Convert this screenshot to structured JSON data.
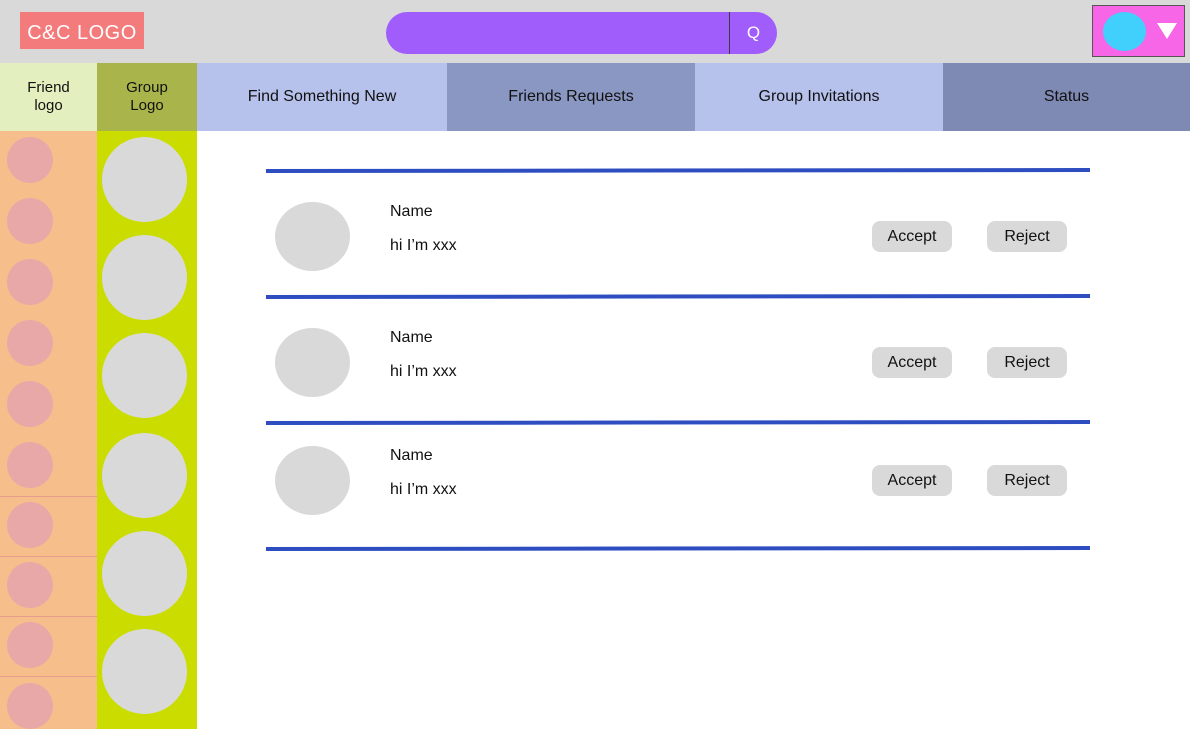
{
  "header": {
    "logo_text": "C&C LOGO",
    "search": {
      "placeholder": "",
      "button_label": "Q"
    },
    "profile": {
      "avatar_icon": "user-avatar",
      "menu_icon": "caret-down-icon"
    }
  },
  "sidebar": {
    "friend_header": "Friend\nlogo",
    "group_header": "Group\nLogo"
  },
  "tabs": [
    {
      "label": "Find Something New"
    },
    {
      "label": "Friends Requests"
    },
    {
      "label": "Group Invitations"
    },
    {
      "label": "Status"
    }
  ],
  "requests": [
    {
      "name": "Name",
      "bio": "hi I’m xxx",
      "accept_label": "Accept",
      "reject_label": "Reject"
    },
    {
      "name": "Name",
      "bio": "hi I’m xxx",
      "accept_label": "Accept",
      "reject_label": "Reject"
    },
    {
      "name": "Name",
      "bio": "hi I’m xxx",
      "accept_label": "Accept",
      "reject_label": "Reject"
    }
  ],
  "colors": {
    "topbar": "#d9d9d9",
    "logo": "#f47b7b",
    "search": "#a15dfb",
    "profile": "#f666e6",
    "avatar": "#41d0fc",
    "friend_column": "#f6be8b",
    "group_column": "#cbdd00",
    "divider": "#2e4dc0"
  }
}
